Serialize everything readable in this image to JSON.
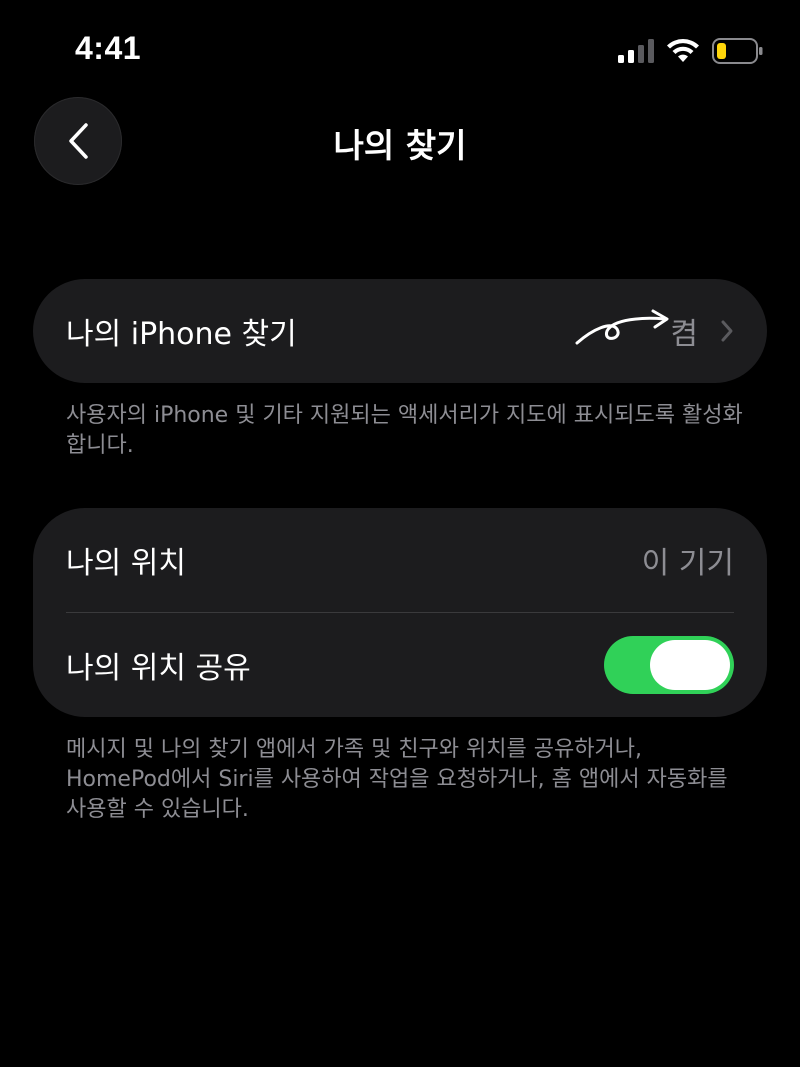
{
  "status_bar": {
    "time": "4:41",
    "icons": [
      "cellular-signal-icon",
      "wifi-icon",
      "battery-low-icon"
    ],
    "battery_color": "#ffd60a"
  },
  "header": {
    "back_icon": "chevron-left-icon",
    "title": "나의 찾기"
  },
  "find_my_iphone": {
    "label": "나의 iPhone 찾기",
    "value": "켬",
    "chevron_icon": "chevron-right-icon",
    "annotation_icon": "handwritten-arrow-annotation",
    "footnote": "사용자의 iPhone 및 기타 지원되는 액세서리가 지도에 표시되도록 활성화합니다."
  },
  "location": {
    "my_location_label": "나의 위치",
    "my_location_value": "이 기기",
    "share_label": "나의 위치 공유",
    "share_enabled": true,
    "footnote": "메시지 및 나의 찾기 앱에서 가족 및 친구와 위치를 공유하거나, HomePod에서 Siri를 사용하여 작업을 요청하거나, 홈 앱에서 자동화를 사용할 수 있습니다."
  },
  "colors": {
    "background": "#000000",
    "group_background": "#1c1c1e",
    "toggle_on": "#30d158",
    "secondary_text": "#8d8d93"
  }
}
